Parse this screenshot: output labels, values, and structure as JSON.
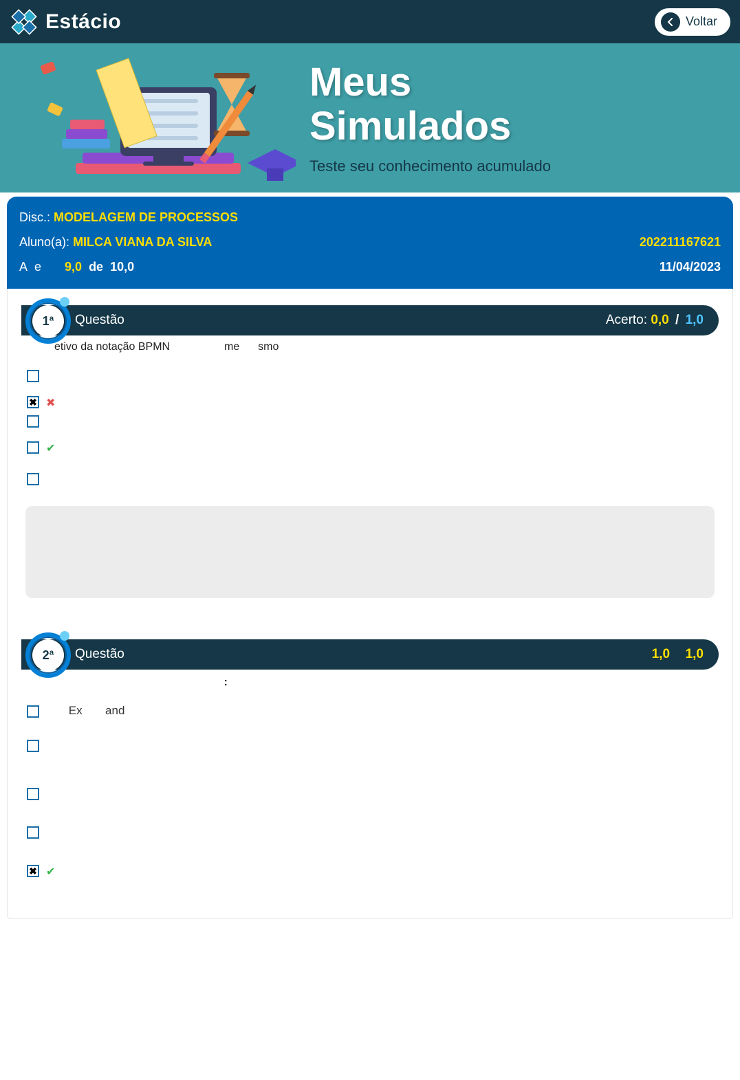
{
  "brand": "Estácio",
  "back_label": "Voltar",
  "hero": {
    "title_line1": "Meus",
    "title_line2": "Simulados",
    "subtitle": "Teste seu conhecimento acumulado"
  },
  "info": {
    "disc_label": "Disc.:",
    "disc_value": "MODELAGEM DE PROCESSOS",
    "aluno_label": "Aluno(a):",
    "aluno_value": "MILCA VIANA DA SILVA",
    "matricula": "202211167621",
    "acertos_label_a": "A",
    "acertos_label_e": "e",
    "score_got": "9,0",
    "score_mid": "de",
    "score_total": "10,0",
    "date": "11/04/2023"
  },
  "q1": {
    "num": "1ª",
    "header_label": "Questão",
    "acerto_label": "Acerto:",
    "acerto_got": "0,0",
    "acerto_total": "1,0",
    "prompt_frag1": "etivo da notação BPMN",
    "prompt_frag2": "me",
    "prompt_frag3": "smo",
    "options": [
      {
        "checked": false,
        "mark": "",
        "text": ""
      },
      {
        "checked": true,
        "mark": "wrong",
        "text": ""
      },
      {
        "checked": false,
        "mark": "",
        "text": ""
      },
      {
        "checked": false,
        "mark": "correct",
        "text": ""
      },
      {
        "checked": false,
        "mark": "",
        "text": ""
      }
    ]
  },
  "q2": {
    "num": "2ª",
    "header_label": "Questão",
    "acerto_got": "1,0",
    "acerto_total": "1,0",
    "prompt_colon": ":",
    "options": [
      {
        "checked": false,
        "mark": "",
        "frag1": "Ex",
        "frag2": "and"
      },
      {
        "checked": false,
        "mark": "",
        "frag1": "",
        "frag2": ""
      },
      {
        "checked": false,
        "mark": "",
        "frag1": "",
        "frag2": ""
      },
      {
        "checked": false,
        "mark": "",
        "frag1": "",
        "frag2": ""
      },
      {
        "checked": true,
        "mark": "correct",
        "frag1": "",
        "frag2": ""
      }
    ]
  }
}
